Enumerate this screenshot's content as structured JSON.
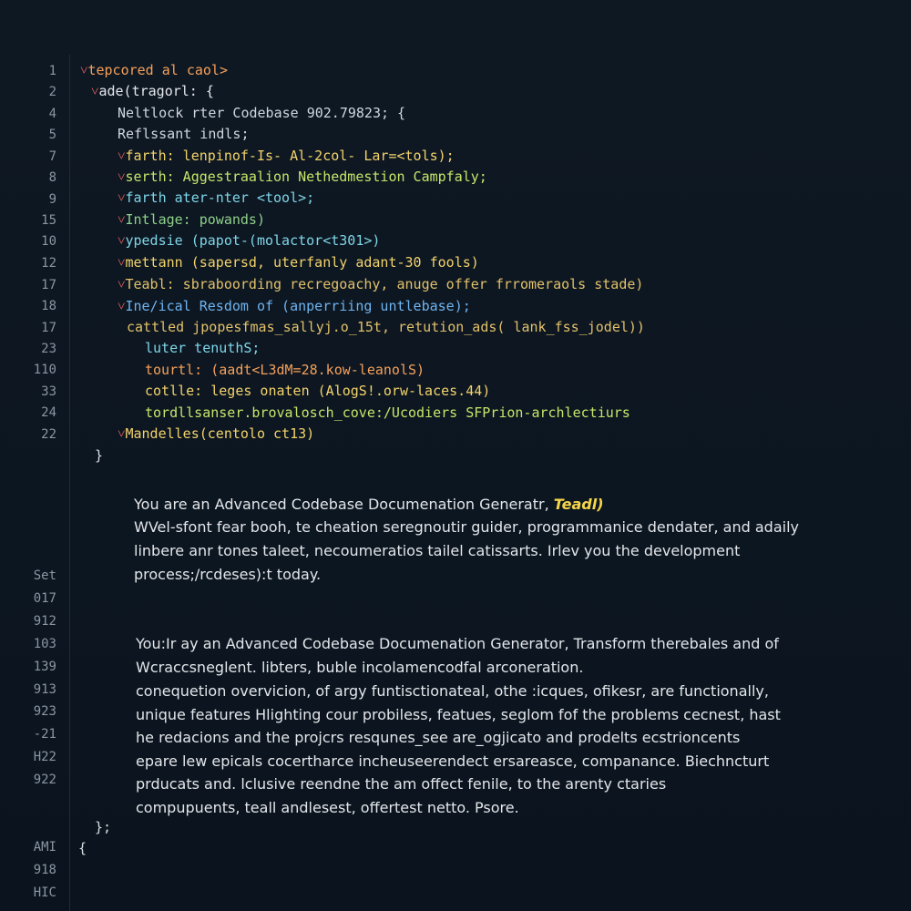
{
  "gutter": {
    "line_numbers_top": [
      "1",
      "2",
      "4",
      "5",
      "7",
      "8",
      "9",
      "15",
      "10",
      "12",
      "17",
      "18",
      "17",
      "23",
      "110",
      "33",
      "24",
      "22"
    ],
    "line_numbers_bottom": [
      "Set",
      "017",
      "912",
      "103",
      "139",
      "913",
      "923",
      "-21",
      "H22",
      "922"
    ],
    "line_numbers_footer": [
      "AMI",
      "918",
      "HIC"
    ]
  },
  "code": {
    "lines": [
      {
        "prefix": "˅",
        "text": "tepcored al caol>"
      },
      {
        "prefix": "˅",
        "text": "ade(tragorl: {"
      },
      {
        "prefix": "",
        "text": "Neltlock rter Codebase 902.79823; {"
      },
      {
        "prefix": "",
        "text": "Reflssant indls;"
      },
      {
        "prefix": "˅",
        "text": "farth: lenpinof-Is- Al-2col- Lar=<tols);"
      },
      {
        "prefix": "˅",
        "text": "serth: Aggestraalion Nethedmestion Campfaly;"
      },
      {
        "prefix": "˅",
        "text": "farth ater-nter <tool>;"
      },
      {
        "prefix": "˅",
        "text": "Intlage: powands)"
      },
      {
        "prefix": "˅",
        "text": "ypedsie (papot-(molactor<t301>)"
      },
      {
        "prefix": "˅",
        "text": "mettann (sapersd, uterfanly adant-30 fools)"
      },
      {
        "prefix": "˅",
        "text": "Teabl: sbraboording recregoachy, anuge offer frromeraols stade)"
      },
      {
        "prefix": "˅",
        "text": "Ine/ical Resdom of (anperriing untlebase);"
      },
      {
        "prefix": "",
        "text": "cattled jpopesfmas_sallyj.o_15t, retution_ads( lank_fss_jodel))"
      },
      {
        "prefix": "",
        "text": "luter tenuthS;"
      },
      {
        "prefix": "",
        "text": "tourtl: (aadt<L3dM=28.kow-leanolS)"
      },
      {
        "prefix": "",
        "text": "cotlle: leges onaten (AlogS!.orw-laces.44)"
      },
      {
        "prefix": "",
        "text": "tordllsanser.brovalosch_cove:/Ucodiers SFPrion-archlectiurs"
      },
      {
        "prefix": "˅",
        "text": "Mandelles(centolo ct13)"
      }
    ],
    "closing_brace": "}",
    "closing_brace_2": "};",
    "opening_brace": "{"
  },
  "paragraph_1": {
    "line_1_main": "You are an Advanced Codebase Documenation Generatr,",
    "line_1_accent": "Teadl)",
    "line_2": "WVel-sfont fear booh, te cheation seregnoutir guider, programmanice dendater, and adaily",
    "line_3": "linbere anr tones taleet,  necoumeratios tailel catissarts.  Irlev you the development",
    "line_4": "process;/rcdeses):t today."
  },
  "paragraph_2": {
    "lines": [
      "You:Ir ay an Advanced Codebase Documenation Generator, Transform therebales and of",
      "Wcraccsneglent. libters, buble incolamencodfal arconeration.",
      "conequetion overvicion,  of argy funtisctionateal,  othe :icques,  ofikesr,  are functionally,",
      "unique features Hlighting cour probiless, featues,  seglom fof the problems cecnest,  hast",
      "he redacions and the projcrs resqunes_see are_ogjicato and prodelts ecstrioncents",
      "epare lew  epicals cocertharce incheuseerendect  ersareasce,  companance. Biechncturt",
      "prducats and. lclusive reendne the  am offect fenile,  to the arenty ctaries",
      "compupuents, teall andlesest,  offertest netto. Psore."
    ]
  },
  "colors": {
    "background": "#0d1621",
    "accent": "#f5d54a"
  }
}
